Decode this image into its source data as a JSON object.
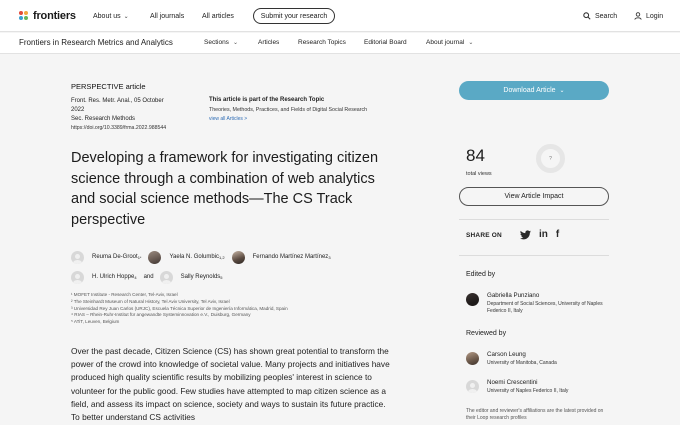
{
  "topbar": {
    "logo_text": "frontiers",
    "nav": [
      "About us",
      "All journals",
      "All articles"
    ],
    "submit_label": "Submit your research",
    "search_label": "Search",
    "login_label": "Login"
  },
  "journalbar": {
    "title": "Frontiers in Research Metrics and Analytics",
    "nav": [
      "Sections",
      "Articles",
      "Research Topics",
      "Editorial Board",
      "About journal"
    ]
  },
  "article": {
    "type": "PERSPECTIVE article",
    "meta_line1": "Front. Res. Metr. Anal., 05 October",
    "meta_line2": "2022",
    "meta_line3": "Sec. Research Methods",
    "doi": "https://doi.org/10.3389/frma.2022.988544",
    "topic_label": "This article is part of the Research Topic",
    "topic_name": "Theories, Methods, Practices, and Fields of Digital Social Research",
    "topic_link": "view all Articles >",
    "title": "Developing a framework for investigating citizen science through a combination of web analytics and social science methods—The CS Track perspective",
    "authors_row1": [
      "Reuma De-Groot",
      "Yaela N. Golumbic",
      "Fernando Martínez Martínez"
    ],
    "authors_row1_sup": [
      "1*",
      "1,2",
      "3"
    ],
    "authors_row2": [
      "H. Ulrich Hoppe",
      "Sally Reynolds"
    ],
    "authors_row2_sup": [
      "4",
      "5"
    ],
    "and_label": "and",
    "affiliations": [
      "¹ MOFET Institute - Research Center, Tel-Aviv, Israel",
      "² The Steinhardt Museum of Natural History, Tel Aviv University, Tel Aviv, Israel",
      "³ Universidad Rey Juan Carlos (URJC), Escuela Técnica Superior de Ingeniería Informática, Madrid, Spain",
      "⁴ RIAS – Rhein-Ruhr-Institut für angewandte Systeminnovation e.V., Duisburg, Germany",
      "⁵ ATiT, Leuven, Belgium"
    ],
    "abstract": "Over the past decade, Citizen Science (CS) has shown great potential to transform the power of the crowd into knowledge of societal value. Many projects and initiatives have produced high quality scientific results by mobilizing peoples' interest in science to volunteer for the public good. Few studies have attempted to map citizen science as a field, and assess its impact on science, society and ways to sustain its future practice. To better understand CS activities"
  },
  "sidebar": {
    "download_label": "Download Article",
    "views_count": "84",
    "views_label": "total views",
    "impact_label": "View Article Impact",
    "share_label": "SHARE ON",
    "edited_by_label": "Edited by",
    "editor": {
      "name": "Gabriella Punziano",
      "affiliation": "Department of Social Sciences, University of Naples Federico II, Italy"
    },
    "reviewed_by_label": "Reviewed by",
    "reviewers": [
      {
        "name": "Carson Leung",
        "affiliation": "University of Manitoba, Canada"
      },
      {
        "name": "Noemi Crescentini",
        "affiliation": "University of Naples Federico II, Italy"
      }
    ],
    "note": "The editor and reviewer's affiliations are the latest provided on their Loop research profiles"
  },
  "colors": {
    "accent": "#5aa9c5",
    "link": "#2f6db5",
    "background": "#f5f5f5"
  }
}
